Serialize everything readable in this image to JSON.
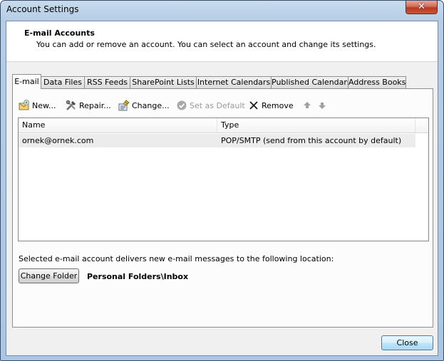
{
  "window": {
    "title": "Account Settings",
    "close_glyph": "✕"
  },
  "header": {
    "title": "E-mail Accounts",
    "description": "You can add or remove an account. You can select an account and change its settings."
  },
  "tabs": [
    {
      "label": "E-mail",
      "active": true
    },
    {
      "label": "Data Files",
      "active": false
    },
    {
      "label": "RSS Feeds",
      "active": false
    },
    {
      "label": "SharePoint Lists",
      "active": false
    },
    {
      "label": "Internet Calendars",
      "active": false
    },
    {
      "label": "Published Calendars",
      "active": false
    },
    {
      "label": "Address Books",
      "active": false
    }
  ],
  "toolbar": {
    "new_label": "New...",
    "repair_label": "Repair...",
    "change_label": "Change...",
    "set_default_label": "Set as Default",
    "remove_label": "Remove"
  },
  "accounts_list": {
    "columns": [
      "Name",
      "Type"
    ],
    "rows": [
      {
        "name": "ornek@ornek.com",
        "type": "POP/SMTP (send from this account by default)"
      }
    ]
  },
  "delivery": {
    "text": "Selected e-mail account delivers new e-mail messages to the following location:",
    "change_folder_label": "Change Folder",
    "folder_path": "Personal Folders\\Inbox"
  },
  "footer": {
    "close_label": "Close"
  }
}
